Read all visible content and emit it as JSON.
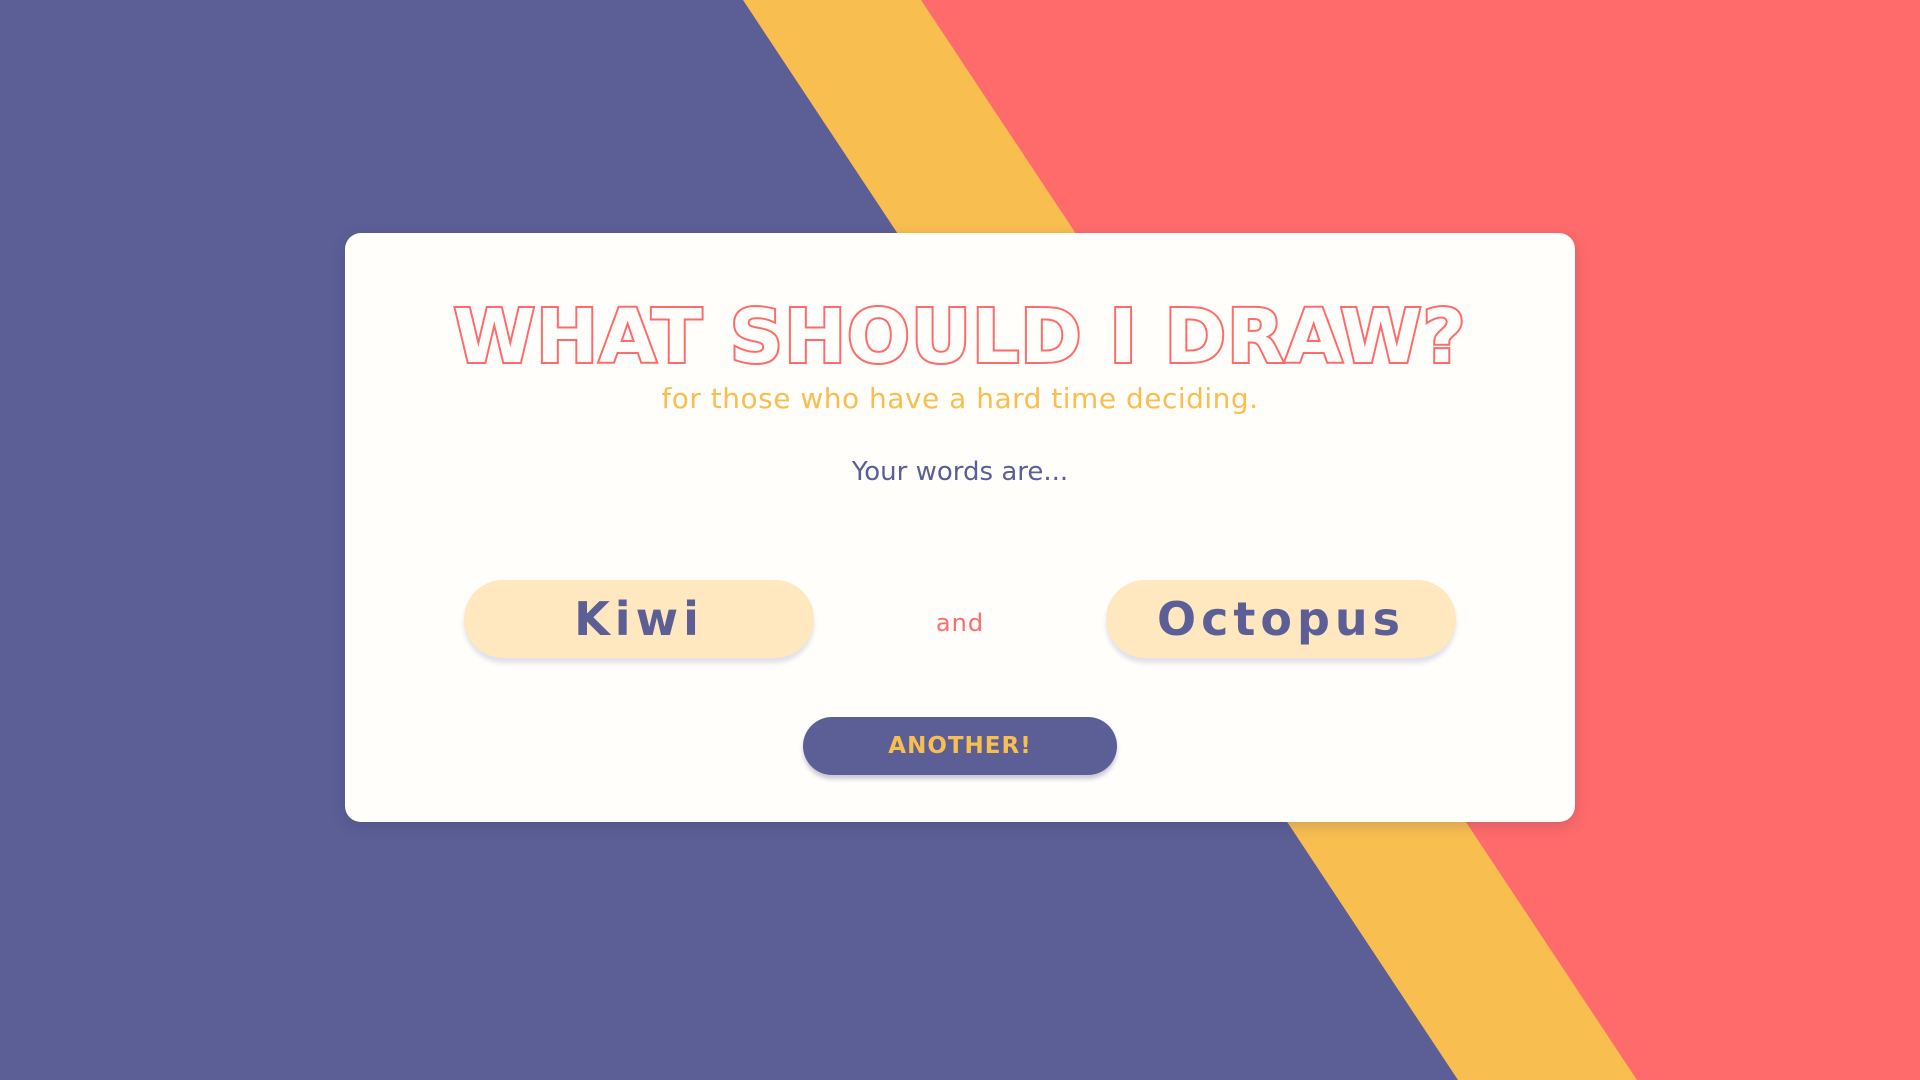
{
  "theme": {
    "background_primary": "#5b5f95",
    "background_stripe": "#f8be50",
    "background_accent": "#ff6b6b",
    "card_background": "#fffefb",
    "title_color": "#ff6b6b",
    "subtitle_color": "#f8be50",
    "prompt_color": "#5b5f95",
    "pill_background": "#ffe7bf",
    "pill_text_color": "#5b5f95",
    "connector_color": "#ff6b6b",
    "button_background": "#5b5f95",
    "button_text_color": "#f8be50"
  },
  "header": {
    "title": "WHAT SHOULD I DRAW?",
    "subtitle": "for those who have a hard time deciding."
  },
  "main": {
    "prompt": "Your words are...",
    "words": [
      "Kiwi",
      "Octopus"
    ],
    "connector": "and",
    "another_label": "ANOTHER!"
  }
}
